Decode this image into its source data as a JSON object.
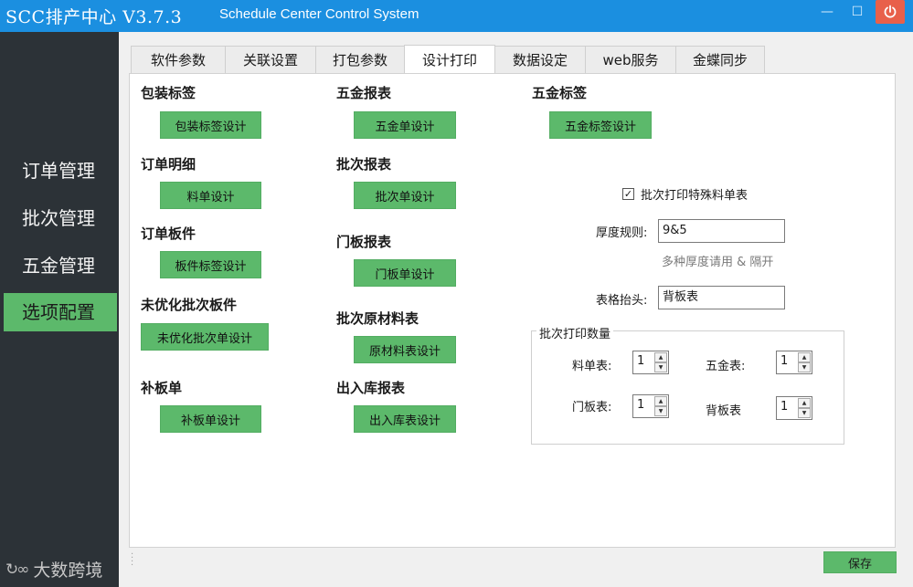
{
  "window": {
    "title": "SCC排产中心 V3.7.3",
    "subtitle": "Schedule Center Control System",
    "minimize_glyph": "—",
    "maximize_glyph": "☐"
  },
  "sidebar": {
    "items": [
      {
        "label": "订单管理"
      },
      {
        "label": "批次管理"
      },
      {
        "label": "五金管理"
      },
      {
        "label": "选项配置"
      }
    ],
    "active_index": 3,
    "brand": "大数跨境"
  },
  "tabs": [
    {
      "label": "软件参数"
    },
    {
      "label": "关联设置"
    },
    {
      "label": "打包参数"
    },
    {
      "label": "设计打印"
    },
    {
      "label": "数据设定"
    },
    {
      "label": "web服务"
    },
    {
      "label": "金蝶同步"
    }
  ],
  "active_tab_index": 3,
  "sections": {
    "col1": [
      {
        "title": "包装标签",
        "button": "包装标签设计"
      },
      {
        "title": "订单明细",
        "button": "料单设计"
      },
      {
        "title": "订单板件",
        "button": "板件标签设计"
      },
      {
        "title": "未优化批次板件",
        "button": "未优化批次单设计"
      },
      {
        "title": "补板单",
        "button": "补板单设计"
      }
    ],
    "col2": [
      {
        "title": "五金报表",
        "button": "五金单设计"
      },
      {
        "title": "批次报表",
        "button": "批次单设计"
      },
      {
        "title": "门板报表",
        "button": "门板单设计"
      },
      {
        "title": "批次原材料表",
        "button": "原材料表设计"
      },
      {
        "title": "出入库报表",
        "button": "出入库表设计"
      }
    ],
    "col3": [
      {
        "title": "五金标签",
        "button": "五金标签设计"
      }
    ]
  },
  "options": {
    "special_checkbox": {
      "label": "批次打印特殊料单表",
      "checked": true,
      "mark": "✓"
    },
    "thickness_label": "厚度规则:",
    "thickness_value": "9&5",
    "thickness_hint": "多种厚度请用 & 隔开",
    "header_label": "表格抬头:",
    "header_value": "背板表"
  },
  "print_qty": {
    "legend": "批次打印数量",
    "fields": [
      {
        "label": "料单表:",
        "value": "1"
      },
      {
        "label": "五金表:",
        "value": "1"
      },
      {
        "label": "门板表:",
        "value": "1"
      },
      {
        "label": "背板表",
        "value": "1"
      }
    ]
  },
  "footer": {
    "save_label": "保存"
  },
  "colors": {
    "titlebar": "#1b8fe0",
    "sidebar": "#2c3237",
    "accent_green": "#5cb96b",
    "close_red": "#e8604a"
  }
}
